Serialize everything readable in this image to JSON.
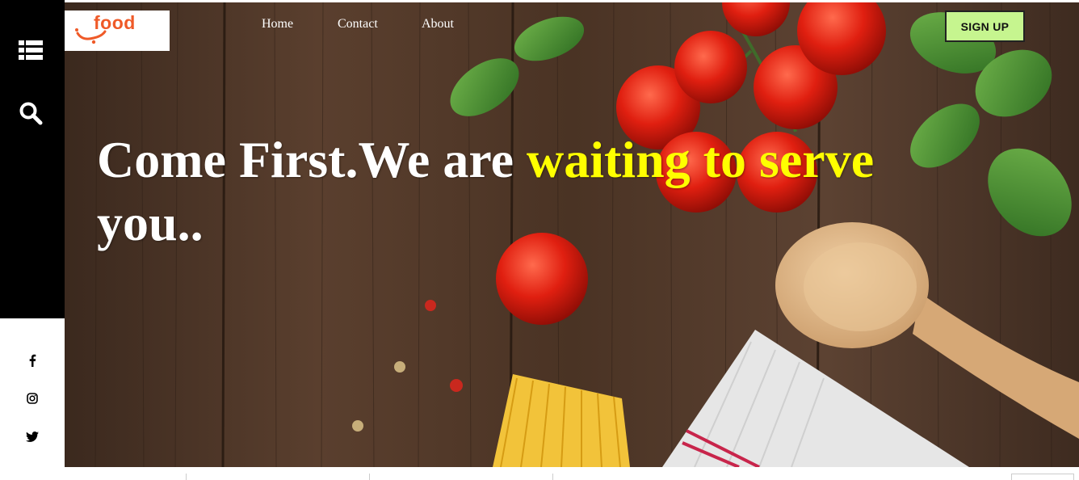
{
  "sidebar": {
    "icons": [
      "list-icon",
      "search-icon"
    ],
    "social": [
      "facebook-icon",
      "instagram-icon",
      "twitter-icon"
    ]
  },
  "header": {
    "logo_text": "food",
    "nav": [
      {
        "label": "Home"
      },
      {
        "label": "Contact"
      },
      {
        "label": "About"
      }
    ],
    "signup_label": "SIGN UP"
  },
  "hero": {
    "headline_white": "Come First.We are ",
    "headline_yellow": "waiting to serve",
    "headline_end": "you.."
  },
  "colors": {
    "sidebar": "#000000",
    "signup_bg": "#c6f58f",
    "headline_accent": "#ffff00",
    "logo": "#ef5a28"
  }
}
